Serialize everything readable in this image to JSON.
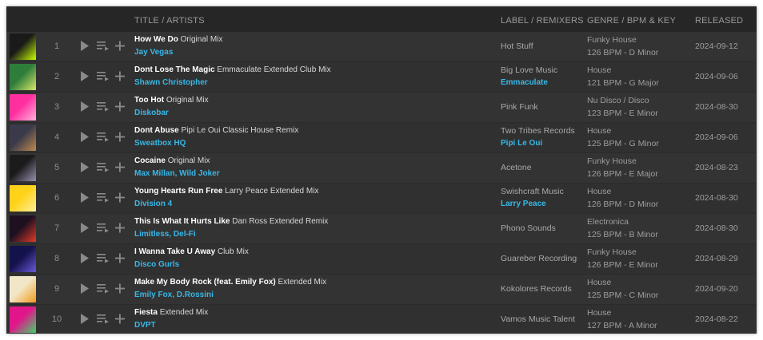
{
  "header": {
    "title": "TITLE / ARTISTS",
    "label": "LABEL / REMIXERS",
    "genre": "GENRE / BPM & KEY",
    "released": "RELEASED"
  },
  "tracks": [
    {
      "num": "1",
      "name": "How We Do",
      "mix": "Original Mix",
      "artists": "Jay Vegas",
      "label": "Hot Stuff",
      "remixers": "",
      "genre": "Funky House",
      "bpm": "126 BPM - D Minor",
      "released": "2024-09-12",
      "art_colors": [
        "#1a1a1a",
        "#c8ff00"
      ]
    },
    {
      "num": "2",
      "name": "Dont Lose The Magic",
      "mix": "Emmaculate Extended Club Mix",
      "artists": "Shawn Christopher",
      "label": "Big Love Music",
      "remixers": "Emmaculate",
      "genre": "House",
      "bpm": "121 BPM - G Major",
      "released": "2024-09-06",
      "art_colors": [
        "#2f7d3a",
        "#d8e86a"
      ]
    },
    {
      "num": "3",
      "name": "Too Hot",
      "mix": "Original Mix",
      "artists": "Diskobar",
      "label": "Pink Funk",
      "remixers": "",
      "genre": "Nu Disco / Disco",
      "bpm": "123 BPM - E Minor",
      "released": "2024-08-30",
      "art_colors": [
        "#ff2fa0",
        "#ffb3dc"
      ]
    },
    {
      "num": "4",
      "name": "Dont Abuse",
      "mix": "Pipi Le Oui Classic House Remix",
      "artists": "Sweatbox HQ",
      "label": "Two Tribes Records",
      "remixers": "Pipi Le Oui",
      "genre": "House",
      "bpm": "125 BPM - G Minor",
      "released": "2024-09-06",
      "art_colors": [
        "#3a3a4a",
        "#c08a50"
      ]
    },
    {
      "num": "5",
      "name": "Cocaine",
      "mix": "Original Mix",
      "artists": "Max Millan, Wild Joker",
      "label": "Acetone",
      "remixers": "",
      "genre": "Funky House",
      "bpm": "126 BPM - E Major",
      "released": "2024-08-23",
      "art_colors": [
        "#1b1b1b",
        "#9a8fb0"
      ]
    },
    {
      "num": "6",
      "name": "Young Hearts Run Free",
      "mix": "Larry Peace Extended Mix",
      "artists": "Division 4",
      "label": "Swishcraft Music",
      "remixers": "Larry Peace",
      "genre": "House",
      "bpm": "126 BPM - D Minor",
      "released": "2024-08-30",
      "art_colors": [
        "#ffd21a",
        "#ffef9a"
      ]
    },
    {
      "num": "7",
      "name": "This Is What It Hurts Like",
      "mix": "Dan Ross Extended Remix",
      "artists": "Limitless, Del-Fi",
      "label": "Phono Sounds",
      "remixers": "",
      "genre": "Electronica",
      "bpm": "125 BPM - B Minor",
      "released": "2024-08-30",
      "art_colors": [
        "#1e1020",
        "#e33a2a"
      ]
    },
    {
      "num": "8",
      "name": "I Wanna Take U Away",
      "mix": "Club Mix",
      "artists": "Disco Gurls",
      "label": "Guareber Recordings",
      "remixers": "",
      "genre": "Funky House",
      "bpm": "126 BPM - E Minor",
      "released": "2024-08-29",
      "art_colors": [
        "#14124a",
        "#6a5ad8"
      ]
    },
    {
      "num": "9",
      "name": "Make My Body Rock (feat. Emily Fox)",
      "mix": "Extended Mix",
      "artists": "Emily Fox, D.Rossini",
      "label": "Kokolores Records",
      "remixers": "",
      "genre": "House",
      "bpm": "125 BPM - C Minor",
      "released": "2024-09-20",
      "art_colors": [
        "#f2e6c8",
        "#f29a1a"
      ]
    },
    {
      "num": "10",
      "name": "Fiesta",
      "mix": "Extended Mix",
      "artists": "DVPT",
      "label": "Vamos Music Talent",
      "remixers": "",
      "genre": "House",
      "bpm": "127 BPM - A Minor",
      "released": "2024-08-22",
      "art_colors": [
        "#e0168a",
        "#3fd46a"
      ]
    }
  ],
  "icons": {
    "play": "play-icon",
    "queue": "add-to-queue-icon",
    "add": "plus-icon"
  },
  "colors": {
    "accent": "#37b8e8",
    "panel": "#2b2b2b",
    "row": "#333333"
  }
}
